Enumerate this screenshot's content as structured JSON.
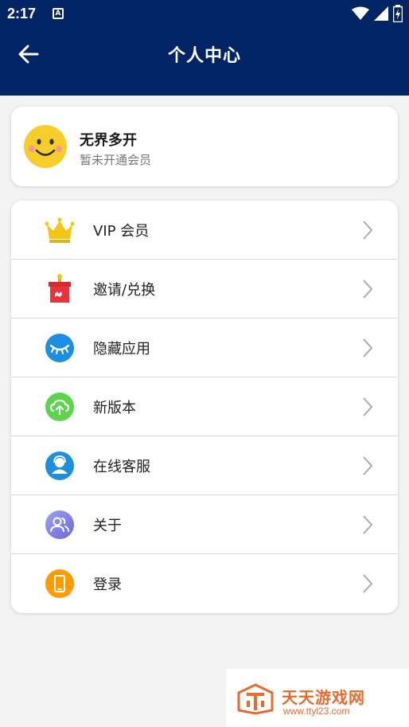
{
  "status_bar": {
    "time": "2:17",
    "notification_icon": "A"
  },
  "header": {
    "title": "个人中心"
  },
  "profile": {
    "name": "无界多开",
    "subtitle": "暂未开通会员"
  },
  "menu": {
    "items": [
      {
        "label": "VIP 会员",
        "icon": "crown-icon",
        "color": "#f5c518"
      },
      {
        "label": "邀请/兑换",
        "icon": "gift-icon",
        "color": "#e8323c"
      },
      {
        "label": "隐藏应用",
        "icon": "closed-eye-icon",
        "color": "#1e8fe0"
      },
      {
        "label": "新版本",
        "icon": "cloud-upload-icon",
        "color": "#5ed44e"
      },
      {
        "label": "在线客服",
        "icon": "customer-service-icon",
        "color": "#1e8fe0"
      },
      {
        "label": "关于",
        "icon": "users-icon",
        "color": "#7a7fe6"
      },
      {
        "label": "登录",
        "icon": "phone-icon",
        "color": "#ff9a00"
      }
    ]
  },
  "watermark": {
    "title": "天天游戏网",
    "url": "www.ttyl23.com"
  },
  "colors": {
    "primary": "#002464",
    "background": "#f3f3f3"
  }
}
